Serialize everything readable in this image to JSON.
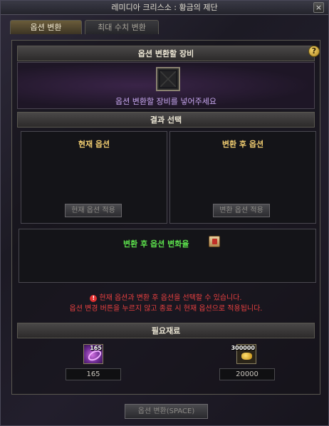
{
  "window": {
    "title": "레미디아 크리스소 : 황금의 제단",
    "close_glyph": "×"
  },
  "tabs": [
    {
      "label": "옵션 변환",
      "active": true
    },
    {
      "label": "최대 수치 변환",
      "active": false
    }
  ],
  "equip_section": {
    "header": "옵션 변환할 장비",
    "hint": "옵션 변환할 장비를 넣어주세요",
    "help_glyph": "?"
  },
  "result_section": {
    "header": "결과 선택",
    "current": {
      "title": "현재 옵션",
      "button": "현재 옵션 적용"
    },
    "after": {
      "title": "변환 후 옵션",
      "button": "변환 옵션 적용"
    },
    "convert_label": "변환 후 옵션 변화율"
  },
  "notice": {
    "line1": "현재 옵션과 변환 후 옵션을 선택할 수 있습니다.",
    "line2": "옵션 변경 버튼을 누르지 않고 종료 시 현재 옵션으로 적용됩니다.",
    "icon_glyph": "!"
  },
  "materials": {
    "header": "필요재료",
    "items": [
      {
        "icon": "purple-gem-icon",
        "badge": "165",
        "value": "165"
      },
      {
        "icon": "gold-coin-icon",
        "badge": "300000",
        "value": "20000"
      }
    ]
  },
  "footer": {
    "convert_button": "옵션 변환(SPACE)"
  },
  "colors": {
    "accent_gold": "#f0cc70",
    "hint_purple": "#c8a8f0",
    "green_label": "#5ce04c",
    "notice_red": "#e84040"
  }
}
